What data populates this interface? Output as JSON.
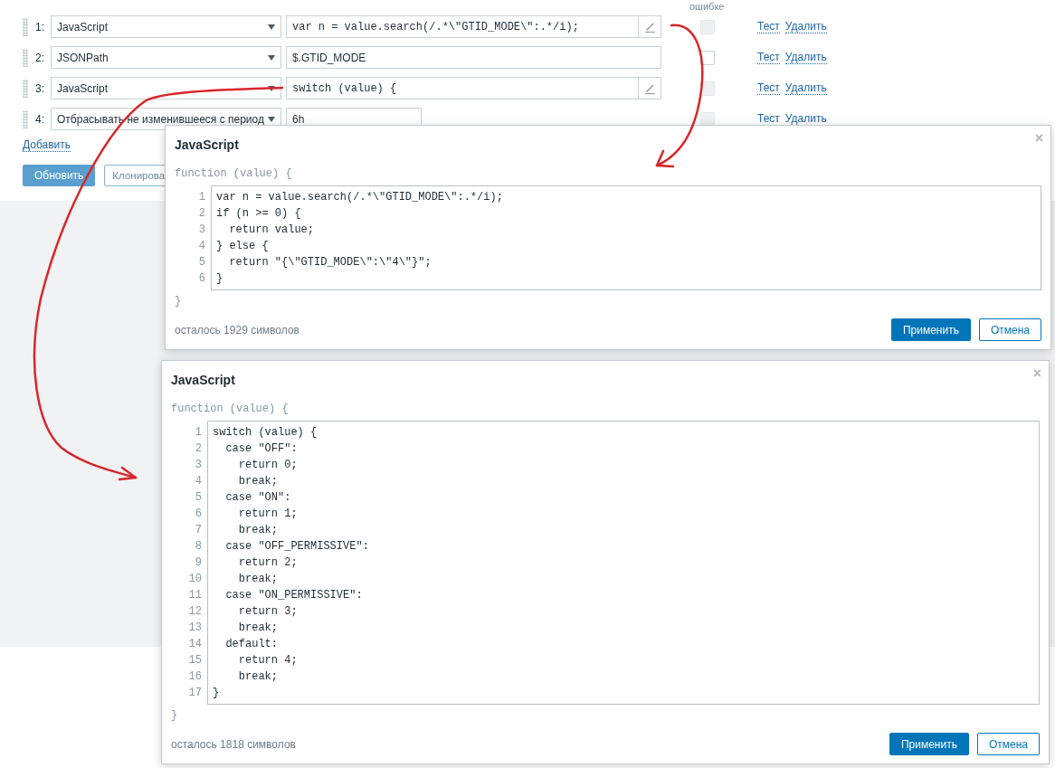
{
  "form": {
    "column_header": "ошибке",
    "steps": [
      {
        "number": "1:",
        "type": "JavaScript",
        "kind": "code",
        "value": "var n = value.search(/.*\\\"GTID_MODE\\\":.*/i);",
        "checkbox_disabled": true,
        "test": "Тест",
        "remove": "Удалить"
      },
      {
        "number": "2:",
        "type": "JSONPath",
        "kind": "text",
        "value": "$.GTID_MODE",
        "checkbox_disabled": false,
        "test": "Тест",
        "remove": "Удалить"
      },
      {
        "number": "3:",
        "type": "JavaScript",
        "kind": "code",
        "value": "switch (value) {",
        "checkbox_disabled": true,
        "test": "Тест",
        "remove": "Удалить"
      },
      {
        "number": "4:",
        "type": "Отбрасывать не изменившееся с период",
        "kind": "short",
        "value": "6h",
        "checkbox_disabled": true,
        "test": "Тест",
        "remove": "Удалить"
      }
    ],
    "add_link": "Добавить",
    "buttons": [
      {
        "label": "Обновить",
        "primary": true
      },
      {
        "label": "Клонирова",
        "primary": false
      }
    ]
  },
  "dialogs": [
    {
      "title": "JavaScript",
      "close": "×",
      "header": "function (value) {",
      "lines": [
        {
          "number": "1",
          "code": "var n = value.search(/.*\\\"GTID_MODE\\\":.*/i);"
        },
        {
          "number": "2",
          "code": "if (n >= 0) {"
        },
        {
          "number": "3",
          "code": "  return value;"
        },
        {
          "number": "4",
          "code": "} else {"
        },
        {
          "number": "5",
          "code": "  return \"{\\\"GTID_MODE\\\":\\\"4\\\"}\";"
        },
        {
          "number": "6",
          "code": "}"
        }
      ],
      "footer_brace": "}",
      "remaining": "осталось 1929 символов",
      "apply": "Применить",
      "cancel": "Отмена"
    },
    {
      "title": "JavaScript",
      "close": "×",
      "header": "function (value) {",
      "lines": [
        {
          "number": "1",
          "code": "switch (value) {"
        },
        {
          "number": "2",
          "code": "  case \"OFF\":"
        },
        {
          "number": "3",
          "code": "    return 0;"
        },
        {
          "number": "4",
          "code": "    break;"
        },
        {
          "number": "5",
          "code": "  case \"ON\":"
        },
        {
          "number": "6",
          "code": "    return 1;"
        },
        {
          "number": "7",
          "code": "    break;"
        },
        {
          "number": "8",
          "code": "  case \"OFF_PERMISSIVE\":"
        },
        {
          "number": "9",
          "code": "    return 2;"
        },
        {
          "number": "10",
          "code": "    break;"
        },
        {
          "number": "11",
          "code": "  case \"ON_PERMISSIVE\":"
        },
        {
          "number": "12",
          "code": "    return 3;"
        },
        {
          "number": "13",
          "code": "    break;"
        },
        {
          "number": "14",
          "code": "  default:"
        },
        {
          "number": "15",
          "code": "    return 4;"
        },
        {
          "number": "16",
          "code": "    break;"
        },
        {
          "number": "17",
          "code": "}"
        }
      ],
      "footer_brace": "}",
      "remaining": "осталось 1818 символов",
      "apply": "Применить",
      "cancel": "Отмена"
    }
  ]
}
